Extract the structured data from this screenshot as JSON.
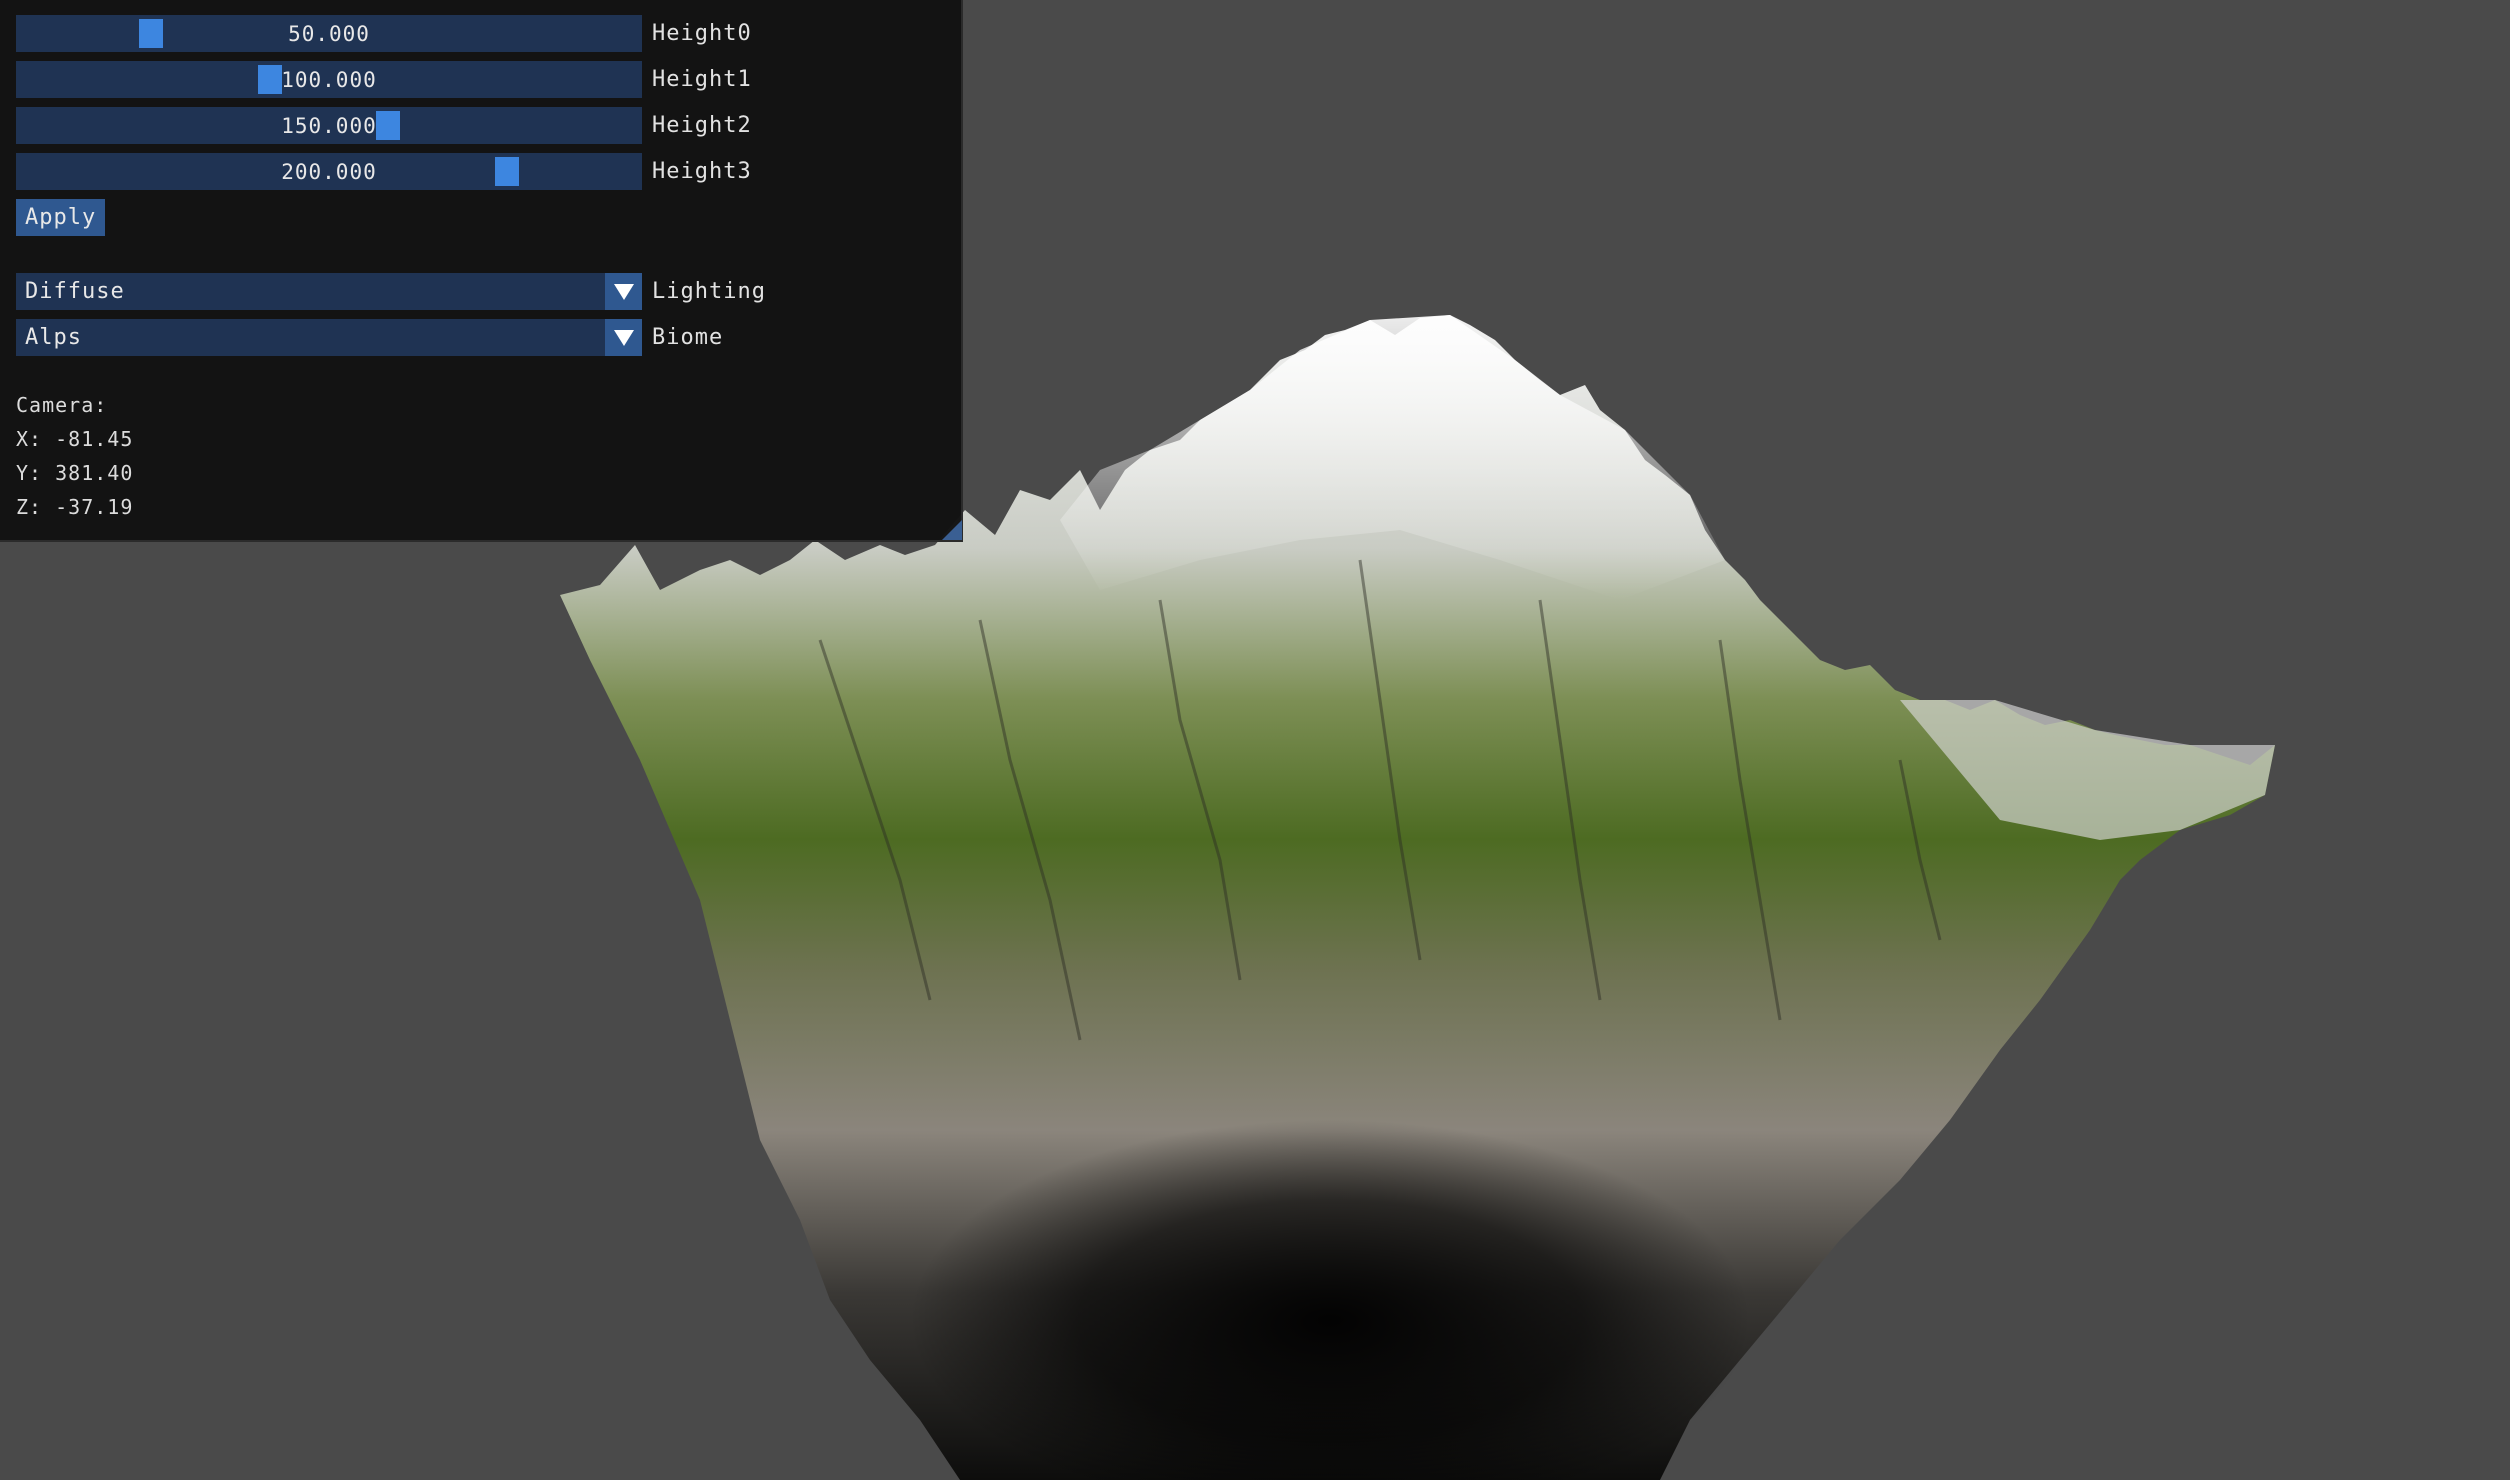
{
  "sliders": [
    {
      "label": "Height0",
      "value_text": "50.000",
      "fraction": 0.215
    },
    {
      "label": "Height1",
      "value_text": "100.000",
      "fraction": 0.405
    },
    {
      "label": "Height2",
      "value_text": "150.000",
      "fraction": 0.595
    },
    {
      "label": "Height3",
      "value_text": "200.000",
      "fraction": 0.785
    }
  ],
  "apply_label": "Apply",
  "combos": [
    {
      "label": "Lighting",
      "value": "Diffuse"
    },
    {
      "label": "Biome",
      "value": "Alps"
    }
  ],
  "camera": {
    "title": "Camera:",
    "x": "X: -81.45",
    "y": "Y: 381.40",
    "z": "Z: -37.19"
  },
  "colors": {
    "background": "#4a4a4a",
    "panel": "#121212",
    "frame": "#1f3353",
    "accent": "#3d86e0",
    "button": "#2f5890",
    "snow": "#e6e6e6",
    "grass": "#4f6e23",
    "rock": "#6e6a62"
  }
}
